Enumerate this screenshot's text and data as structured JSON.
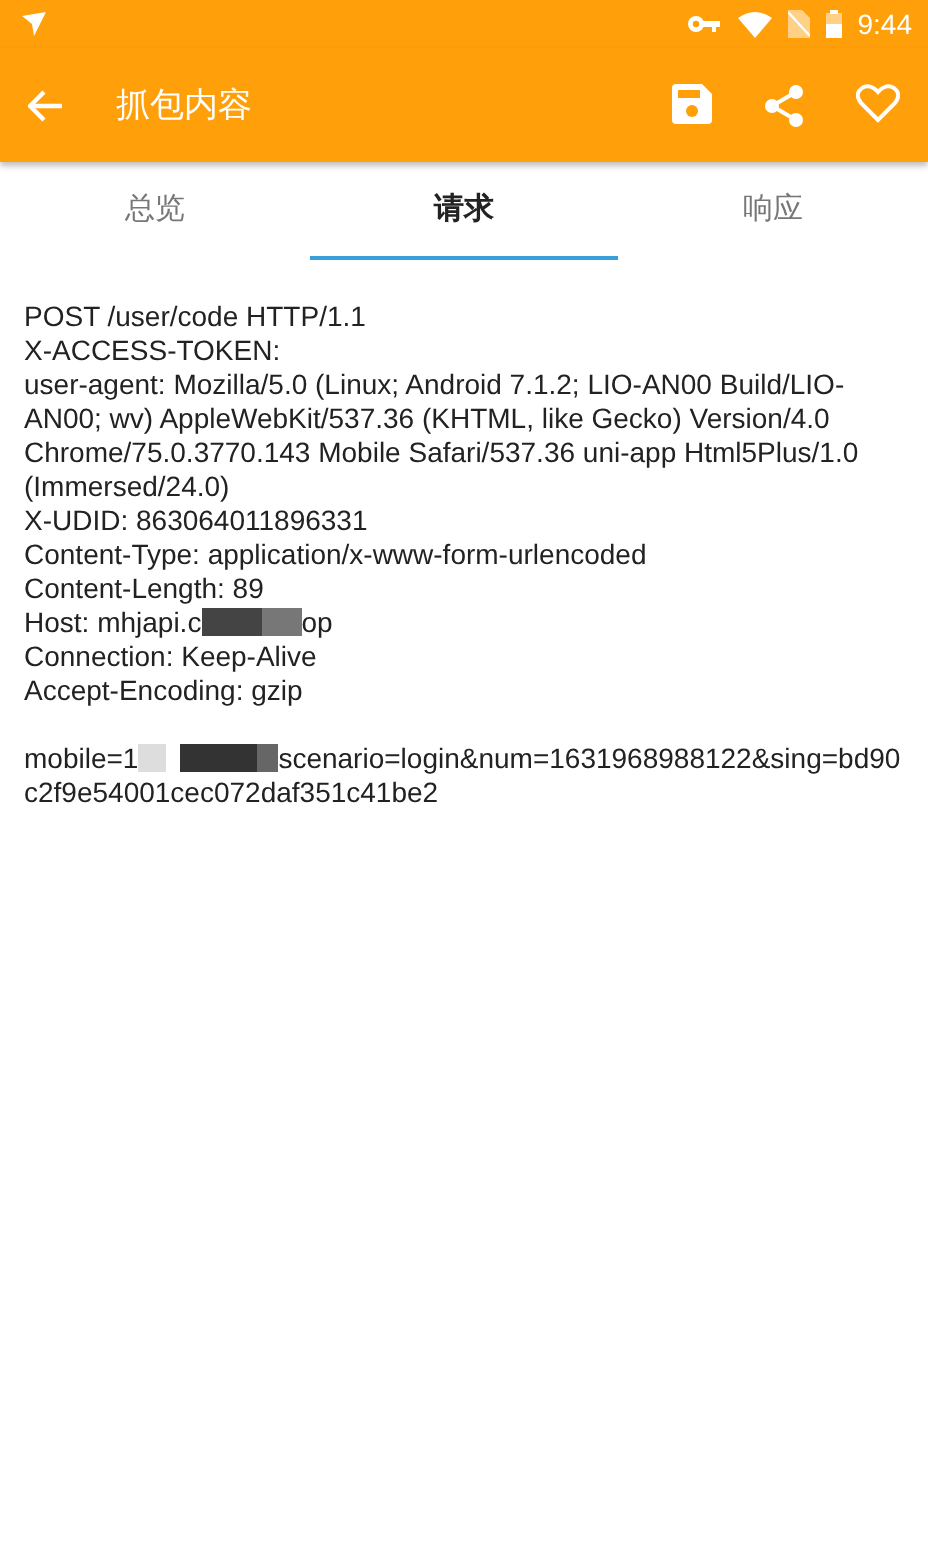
{
  "status_bar": {
    "time": "9:44"
  },
  "app_bar": {
    "title": "抓包内容"
  },
  "tabs": [
    {
      "label": "总览",
      "selected": false
    },
    {
      "label": "请求",
      "selected": true
    },
    {
      "label": "响应",
      "selected": false
    }
  ],
  "headers": [
    {
      "parts": [
        "POST /user/code HTTP/1.1"
      ]
    },
    {
      "parts": [
        "X-ACCESS-TOKEN:"
      ]
    },
    {
      "parts": [
        "user-agent: Mozilla/5.0 (Linux; Android 7.1.2; LIO-AN00 Build/LIO-AN00; wv) AppleWebKit/537.36 (KHTML, like Gecko) Version/4.0 Chrome/75.0.3770.143 Mobile Safari/537.36 uni-app Html5Plus/1.0 (Immersed/24.0)"
      ]
    },
    {
      "parts": [
        "X-UDID: 863064011896331"
      ]
    },
    {
      "parts": [
        "Content-Type: application/x-www-form-urlencoded"
      ]
    },
    {
      "parts": [
        "Content-Length: 89"
      ]
    },
    {
      "parts": [
        "Host: mhjapi.c",
        "op"
      ]
    },
    {
      "parts": [
        "Connection: Keep-Alive"
      ]
    },
    {
      "parts": [
        "Accept-Encoding: gzip"
      ]
    }
  ],
  "body": {
    "parts": [
      "mobile=1",
      "scenario=login&num=1631968988122&sing=bd90c2f9e54001cec072daf351c41be2"
    ]
  }
}
